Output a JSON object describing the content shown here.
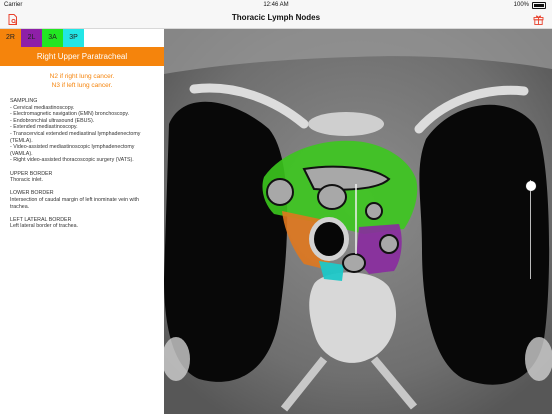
{
  "status_bar": {
    "carrier": "Carrier",
    "time": "12:46 AM",
    "battery": "100%"
  },
  "nav": {
    "title": "Thoracic Lymph Nodes",
    "left_icon": "document-icon",
    "right_icon": "gift-icon",
    "accent": "#e8412c"
  },
  "tabs": [
    {
      "label": "2R",
      "color": "#f5840c"
    },
    {
      "label": "2L",
      "color": "#8e1fa8"
    },
    {
      "label": "3A",
      "color": "#22e622"
    },
    {
      "label": "3P",
      "color": "#22e6e6"
    }
  ],
  "station": {
    "title": "Right Upper Paratracheal",
    "staging_lines": [
      "N2 if right lung cancer.",
      "N3 if left lung cancer."
    ]
  },
  "sampling": {
    "heading": "SAMPLING",
    "lines": [
      "- Cervical mediastinoscopy.",
      "- Electromagnetic navigation (EMN) bronchoscopy.",
      "- Endobronchial ultrasound (EBUS).",
      "- Extended mediastinoscopy.",
      "- Transcervical extended mediastinal lymphadenectomy",
      "(TEMLA).",
      "- Video-assisted mediastinoscopic lymphadenectomy",
      "(VAMLA).",
      "- Right video-assisted thoracoscopic surgery (VATS)."
    ]
  },
  "upper_border": {
    "heading": "UPPER BORDER",
    "text": "Thoracic inlet."
  },
  "lower_border": {
    "heading": "LOWER BORDER",
    "lines": [
      "Intersection of caudal margin of left inominate vein with",
      "trachea."
    ]
  },
  "left_lateral_border": {
    "heading": "LEFT LATERAL BORDER",
    "text": "Left lateral border of trachea."
  },
  "image_viewer": {
    "slider_position": 0.06,
    "region_colors": {
      "2R": "#e0781e",
      "2L": "#8a2aa0",
      "3A": "#3cc81e",
      "3P": "#1ec8c8"
    }
  }
}
